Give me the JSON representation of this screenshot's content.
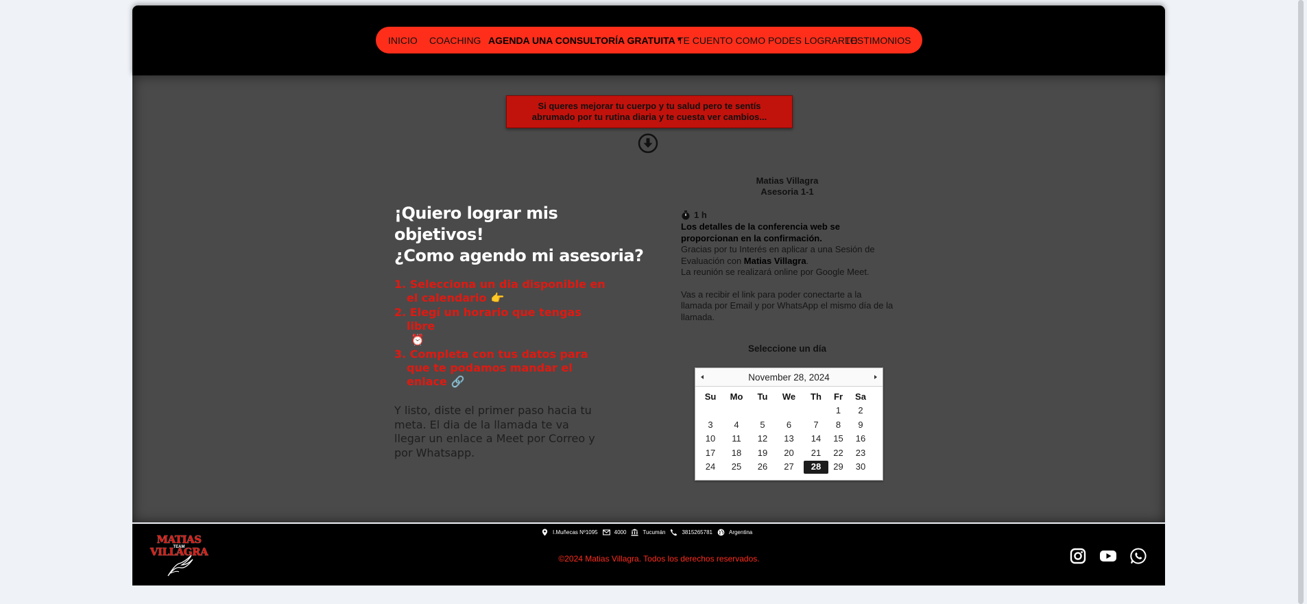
{
  "nav": {
    "items": [
      {
        "label": "INICIO"
      },
      {
        "label": "COACHING"
      },
      {
        "label": "AGENDA UNA CONSULTORÍA GRATUITA *"
      },
      {
        "label": "TE CUENTO COMO PODES LOGRARLO"
      },
      {
        "label": "TESTIMONIOS"
      }
    ],
    "active": "AGENDA UNA CONSULTORÍA GRATUITA *"
  },
  "banner": {
    "text": "Si queres mejorar tu cuerpo y tu salud pero te sentís abrumado por tu rutina diaria y te cuesta ver cambios..."
  },
  "intro": {
    "heading_line1": "¡Quiero lograr mis objetivos!",
    "heading_line2": "¿Como agendo mi asesoria?",
    "steps": [
      {
        "text": "1. Selecciona un dia disponible en el calendario",
        "emoji": "👉"
      },
      {
        "text": "2. Elegí un horario que tengas libre",
        "emoji": "⏰"
      },
      {
        "text": "3. Completa con tus datos para que te podamos mandar el enlace",
        "emoji": "🔗"
      }
    ],
    "note": "Y listo, diste el primer paso hacia tu meta. El dia de la llamada te va llegar un enlace a Meet por Correo y por Whatsapp."
  },
  "booking": {
    "organizer": "Matias Villagra",
    "event_name": "Asesoria 1-1",
    "duration": "1 h",
    "conference_note": "Los detalles de la conferencia web se proporcionan en la confirmación.",
    "desc_part1": "Gracias por tu Interés en aplicar a una Sesión de Evaluación con ",
    "desc_name": "Matias Villagra",
    "desc_part2": ".",
    "desc_line2": "La reunión se realizará online por Google Meet.",
    "desc_line3": "Vas a recibir el link para poder conectarte a la llamada por Email y por WhatsApp el mismo día de la llamada.",
    "select_day_label": "Seleccione un día"
  },
  "calendar": {
    "month_label": "November 28, 2024",
    "weekdays": [
      "Su",
      "Mo",
      "Tu",
      "We",
      "Th",
      "Fr",
      "Sa"
    ],
    "first_weekday_index": 5,
    "days_in_month": 30,
    "selected_day": 28
  },
  "footer": {
    "logo_text": "MATIAS VILLAGRA",
    "logo_sub": "TEAM",
    "address": "I.Muñecas Nº1095",
    "postal_code": "4000",
    "province": "Tucumán",
    "phone": "3815265781",
    "country": "Argentina",
    "copyright": "©2024 Matias Villagra. Todos los derechos reservados."
  },
  "colors": {
    "accent_red": "#ff2e1a",
    "banner_red": "#c2120c",
    "dark_bg": "#4a4a4a",
    "header_bg": "#000000"
  },
  "icons": {
    "social": [
      "instagram-icon",
      "youtube-icon",
      "whatsapp-icon"
    ]
  }
}
